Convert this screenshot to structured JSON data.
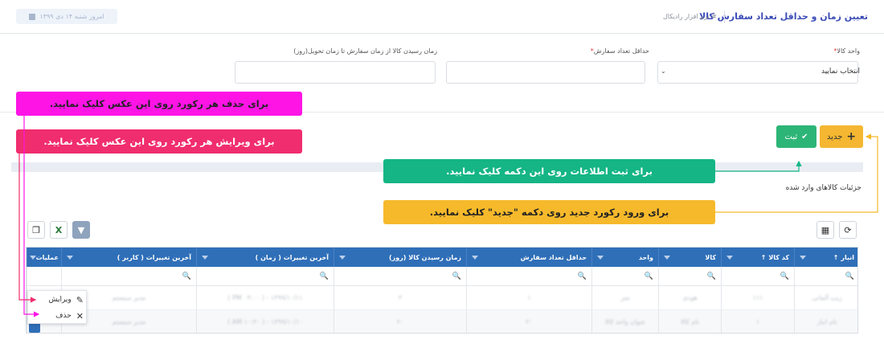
{
  "header": {
    "title": "تعیین زمان و حداقل تعداد سفارش کالا",
    "breadcrumb": "# نرم افزار رادیکال",
    "date_chip": "امروز شنبه ۱۴ دی ۱۳۹۹"
  },
  "form": {
    "unit": {
      "label": "واحد کالا",
      "required": "*",
      "value": "انتخاب نمایید"
    },
    "min_qty": {
      "label": "حداقل تعداد سفارش",
      "required": "*",
      "value": ""
    },
    "lead_time": {
      "label": "زمان رسیدن کالا از زمان سفارش تا زمان تحویل(روز)",
      "value": ""
    }
  },
  "buttons": {
    "new": "جدید",
    "save": "ثبت"
  },
  "section_title": "جزئیات کالاهای وارد شده",
  "grid": {
    "columns": [
      {
        "label": "انبار",
        "sort": true
      },
      {
        "label": "کد کالا",
        "sort": true
      },
      {
        "label": "کالا",
        "sort": false
      },
      {
        "label": "واحد",
        "sort": false
      },
      {
        "label": "حداقل تعداد سفارش",
        "sort": false
      },
      {
        "label": "زمان رسیدن کالا (روز)",
        "sort": false
      },
      {
        "label": "آخرین تغییرات ( زمان )",
        "sort": false
      },
      {
        "label": "آخرین تغییرات ( کاربر )",
        "sort": false
      },
      {
        "label": "عملیات",
        "sort": false
      }
    ],
    "sort_glyph": "↑",
    "rows": [
      [
        "زیپ آلمانی",
        "۱۱۱",
        "هودی",
        "متر",
        "۱",
        "۳",
        "۱۳۹۹/۱۰/۱۱ - ( PM ۰۳:۰۰ )",
        "مدیر سیستم"
      ],
      [
        "نام انبار",
        "۱",
        "نام کالا",
        "عنوان واحد کالا",
        "۲۰",
        "۲۰",
        "۱۳۹۹/۱۰/۱۰ - ( AM ۱۰:۳۰ )",
        "مدیر سیستم"
      ]
    ]
  },
  "context_menu": {
    "edit": "ویرایش",
    "delete": "حذف"
  },
  "callouts": {
    "delete": "برای حذف هر رکورد روی این عکس کلیک نمایید.",
    "edit": "برای ویرایش هر رکورد روی این عکس کلیک نمایید.",
    "save": "برای ثبت اطلاعات روی این دکمه کلیک نمایید.",
    "new": "برای ورود رکورد جدید روی دکمه \"جدید\" کلیک نمایید."
  },
  "icons": {
    "search": "🔍",
    "refresh": "⟳",
    "columns": "▦",
    "filter": "▼",
    "excel": "X",
    "copy": "❐",
    "pencil": "✎",
    "close": "✕",
    "check": "✔",
    "plus": "+"
  },
  "colors": {
    "grid_header": "#2f6fb8",
    "btn_new": "#f5b731",
    "btn_save": "#2db577",
    "callout_magenta": "#ff14e6",
    "callout_rose": "#f02d6e",
    "callout_green": "#15b585",
    "callout_yellow": "#f6b92b"
  }
}
